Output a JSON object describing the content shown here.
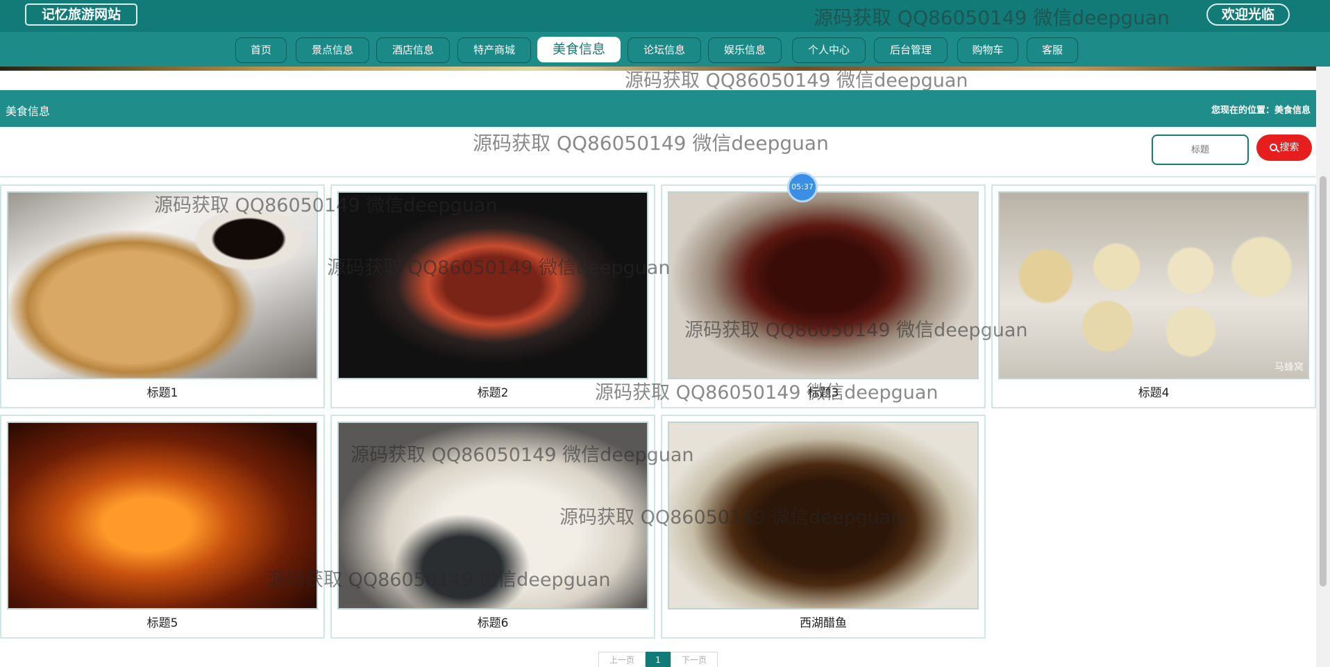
{
  "header": {
    "brand": "记忆旅游网站",
    "welcome": "欢迎光临",
    "watermark": "源码获取 QQ86050149 微信deepguan"
  },
  "nav": {
    "items": [
      "首页",
      "景点信息",
      "酒店信息",
      "特产商城",
      "美食信息",
      "论坛信息",
      "娱乐信息",
      "个人中心",
      "后台管理",
      "购物车",
      "客服"
    ],
    "active": "美食信息"
  },
  "section": {
    "title": "美食信息",
    "breadcrumb": "您现在的位置：美食信息"
  },
  "search": {
    "placeholder": "标题",
    "button": "搜索"
  },
  "timer": "05:37",
  "cards": [
    {
      "caption": "标题1"
    },
    {
      "caption": "标题2"
    },
    {
      "caption": "标题3"
    },
    {
      "caption": "标题4"
    },
    {
      "caption": "标题5"
    },
    {
      "caption": "标题6"
    },
    {
      "caption": "西湖醋鱼"
    }
  ],
  "photo_watermark": "马蜂窝",
  "pagination": {
    "prev": "上一页",
    "current": "1",
    "next": "下一页"
  },
  "colors": {
    "header": "#127a77",
    "nav": "#1d8b88",
    "search_button": "#e61e1e"
  }
}
